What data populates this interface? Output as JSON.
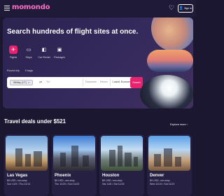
{
  "header": {
    "logo": "momondo",
    "signin_label": "Sign in",
    "heart_icon": "heart-icon",
    "person_icon": "person-icon"
  },
  "hero": {
    "title": "Search hundreds of flight sites at once.",
    "verticals": [
      {
        "label": "Flights",
        "icon": "plane-icon",
        "active": true
      },
      {
        "label": "Stays",
        "icon": "bed-icon",
        "active": false
      },
      {
        "label": "Car Rental",
        "icon": "car-icon",
        "active": false
      },
      {
        "label": "Packages",
        "icon": "suitcase-icon",
        "active": false
      }
    ],
    "trip_type": "Round-trip",
    "bags": "0 bags",
    "search": {
      "origin": "Whitby (CT)",
      "to_placeholder": "To?",
      "depart_placeholder": "Departure",
      "return_placeholder": "Return",
      "passengers": "1 adult, Economy",
      "button_label": "Search"
    }
  },
  "deals": {
    "title": "Travel deals under $521",
    "explore_label": "Explore more ›",
    "cards": [
      {
        "city": "Las Vegas",
        "sub": "$9 USD, non-stop",
        "dates": "Sun 11/9 • Thu 11/13"
      },
      {
        "city": "Phoenix",
        "sub": "$9 USD, non-stop",
        "dates": "Thu 11/20 • Sun 11/23"
      },
      {
        "city": "Houston",
        "sub": "$9 USD, non-stop",
        "dates": "Sat 11/8 • Sat 11/15"
      },
      {
        "city": "Denver",
        "sub": "$9 USD, non-stop",
        "dates": "Wed 11/19 • Sat 11/22"
      }
    ]
  },
  "colors": {
    "background": "#1b1730",
    "accent": "#e7236f"
  }
}
